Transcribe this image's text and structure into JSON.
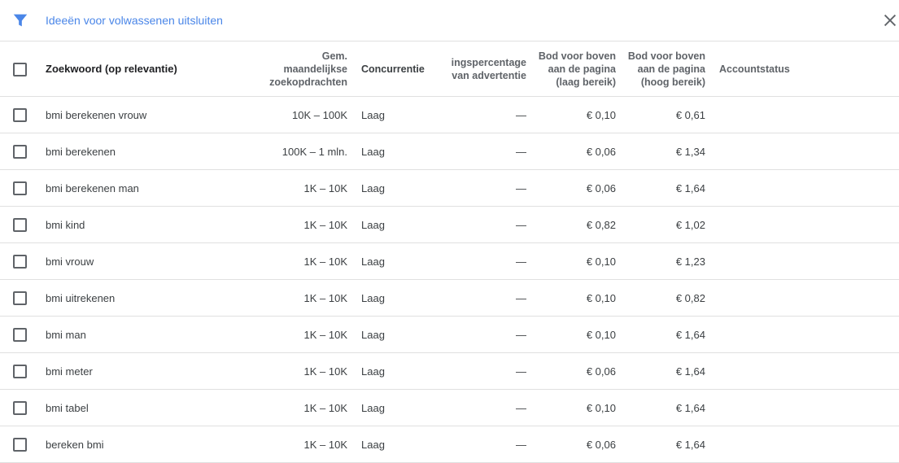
{
  "toolbar": {
    "filter_icon": "filter-icon",
    "filter_label": "Ideeën voor volwassenen uitsluiten",
    "close_icon": "close-icon",
    "accent_color": "#4a86e8"
  },
  "table": {
    "headers": {
      "keyword": "Zoekwoord (op relevantie)",
      "volume_line1": "Gem.",
      "volume_line2": "maandelijkse",
      "volume_line3": "zoekopdrachten",
      "competition": "Concurrentie",
      "impression_line1": "ingspercentage",
      "impression_line2": "van advertentie",
      "bid_low_line1": "Bod voor boven",
      "bid_low_line2": "aan de pagina",
      "bid_low_line3": "(laag bereik)",
      "bid_high_line1": "Bod voor boven",
      "bid_high_line2": "aan de pagina",
      "bid_high_line3": "(hoog bereik)",
      "account_status": "Accountstatus"
    },
    "rows": [
      {
        "keyword": "bmi berekenen vrouw",
        "volume": "10K – 100K",
        "competition": "Laag",
        "impression": "—",
        "bid_low": "€ 0,10",
        "bid_high": "€ 0,61",
        "account_status": ""
      },
      {
        "keyword": "bmi berekenen",
        "volume": "100K – 1 mln.",
        "competition": "Laag",
        "impression": "—",
        "bid_low": "€ 0,06",
        "bid_high": "€ 1,34",
        "account_status": ""
      },
      {
        "keyword": "bmi berekenen man",
        "volume": "1K – 10K",
        "competition": "Laag",
        "impression": "—",
        "bid_low": "€ 0,06",
        "bid_high": "€ 1,64",
        "account_status": ""
      },
      {
        "keyword": "bmi kind",
        "volume": "1K – 10K",
        "competition": "Laag",
        "impression": "—",
        "bid_low": "€ 0,82",
        "bid_high": "€ 1,02",
        "account_status": ""
      },
      {
        "keyword": "bmi vrouw",
        "volume": "1K – 10K",
        "competition": "Laag",
        "impression": "—",
        "bid_low": "€ 0,10",
        "bid_high": "€ 1,23",
        "account_status": ""
      },
      {
        "keyword": "bmi uitrekenen",
        "volume": "1K – 10K",
        "competition": "Laag",
        "impression": "—",
        "bid_low": "€ 0,10",
        "bid_high": "€ 0,82",
        "account_status": ""
      },
      {
        "keyword": "bmi man",
        "volume": "1K – 10K",
        "competition": "Laag",
        "impression": "—",
        "bid_low": "€ 0,10",
        "bid_high": "€ 1,64",
        "account_status": ""
      },
      {
        "keyword": "bmi meter",
        "volume": "1K – 10K",
        "competition": "Laag",
        "impression": "—",
        "bid_low": "€ 0,06",
        "bid_high": "€ 1,64",
        "account_status": ""
      },
      {
        "keyword": "bmi tabel",
        "volume": "1K – 10K",
        "competition": "Laag",
        "impression": "—",
        "bid_low": "€ 0,10",
        "bid_high": "€ 1,64",
        "account_status": ""
      },
      {
        "keyword": "bereken bmi",
        "volume": "1K – 10K",
        "competition": "Laag",
        "impression": "—",
        "bid_low": "€ 0,06",
        "bid_high": "€ 1,64",
        "account_status": ""
      }
    ]
  }
}
